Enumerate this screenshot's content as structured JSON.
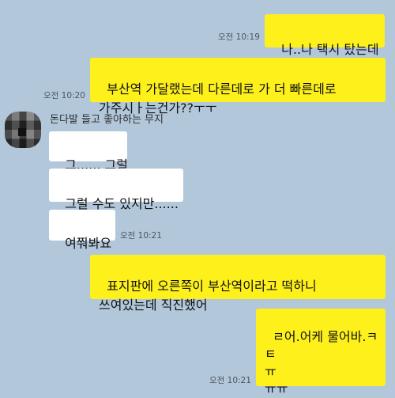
{
  "colors": {
    "background": "#b2c7d9",
    "outgoing_bubble": "#fef01b",
    "incoming_bubble": "#ffffff"
  },
  "messages": [
    {
      "direction": "outgoing",
      "text": "나..나 택시 탔는데",
      "time": "오전 10:19"
    },
    {
      "direction": "outgoing",
      "text": "부산역 가달랬는데 다른데로 가 더 빠른데로\n가주시ㅏ는건가??ㅜㅜ",
      "time": "오전 10:20"
    },
    {
      "direction": "incoming",
      "sender": "돈다발 들고 좋아하는 무지",
      "text": "그...... 그럴"
    },
    {
      "direction": "incoming",
      "text": "그럴 수도 있지만......"
    },
    {
      "direction": "incoming",
      "text": "여쭤봐요",
      "time": "오전 10:21"
    },
    {
      "direction": "outgoing",
      "text": "표지판에 오른쪽이 부산역이라고 떡하니\n쓰여있는데 직진했어"
    },
    {
      "direction": "outgoing",
      "text": "ㄹ어.어케 물어바.ㅋ\nㅌ\nㅠ\nㅠㅠ",
      "time": "오전 10:21"
    }
  ]
}
